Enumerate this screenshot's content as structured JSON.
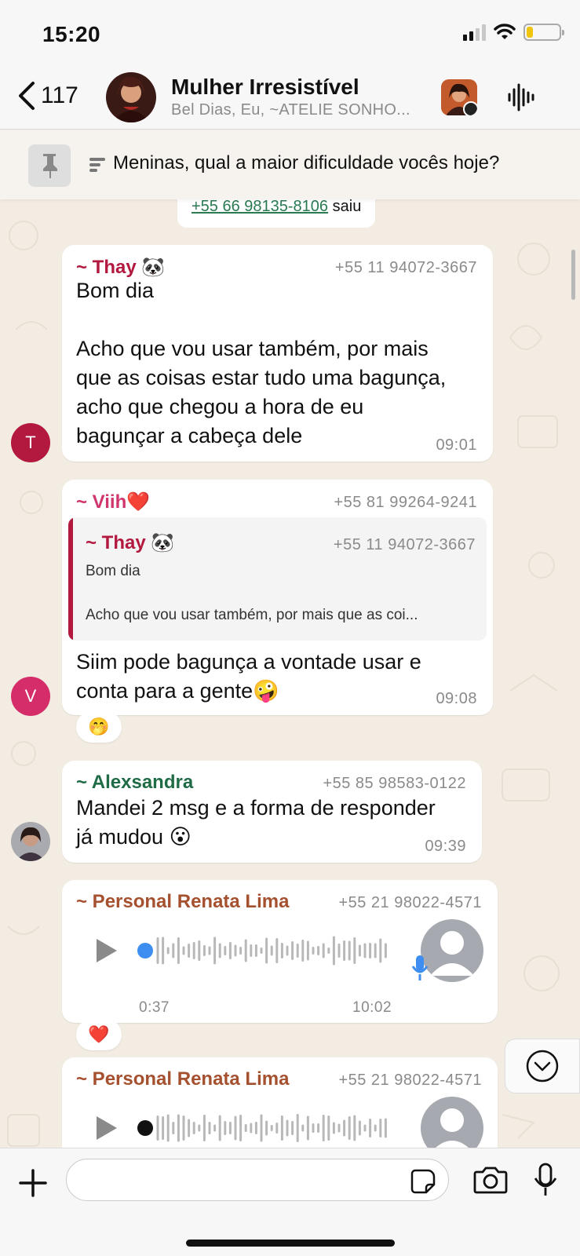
{
  "status_bar": {
    "time": "15:20",
    "battery_level": 0.2
  },
  "header": {
    "back_count": "117",
    "group_name": "Mulher Irresistível",
    "members": "Bel Dias, Eu, ~ATELIE SONHO..."
  },
  "pinned": {
    "text": "Meninas, qual a maior dificuldade vocês hoje?"
  },
  "system_message": {
    "phone": "+55 66 98135-8106",
    "action": "saiu"
  },
  "messages": [
    {
      "sender": "~ Thay 🐼",
      "sender_color": "#b3193f",
      "phone": "+55 11 94072-3667",
      "body": "Bom dia\n\nAcho que vou usar também, por mais\nque as coisas estar tudo uma bagunça,\nacho que chegou a hora de eu\nbagunçar a cabeça dele",
      "time": "09:01",
      "avatar_letter": "T",
      "avatar_color": "#b3193f"
    },
    {
      "sender": "~ Viih❤️",
      "sender_color": "#d0356e",
      "phone": "+55 81 99264-9241",
      "quote": {
        "sender": "~ Thay 🐼",
        "phone": "+55 11 94072-3667",
        "line1": "Bom dia",
        "line2": "Acho que vou usar também, por mais que as coi..."
      },
      "body": "Siim pode bagunça a vontade usar e\nconta para a gente🤪",
      "time": "09:08",
      "avatar_letter": "V",
      "avatar_color": "#d42d6a",
      "reaction": "🤭"
    },
    {
      "sender": "~ Alexsandra",
      "sender_color": "#1f6b46",
      "phone": "+55 85 98583-0122",
      "body": "Mandei 2 msg e a forma de responder\njá mudou 😮",
      "time": "09:39"
    },
    {
      "sender": "~ Personal Renata Lima",
      "sender_color": "#a5502f",
      "phone": "+55 21 98022-4571",
      "audio_duration": "0:37",
      "time": "10:02",
      "reaction": "❤️"
    },
    {
      "sender": "~ Personal Renata Lima",
      "sender_color": "#a5502f",
      "phone": "+55 21 98022-4571"
    }
  ],
  "input": {
    "placeholder": ""
  }
}
